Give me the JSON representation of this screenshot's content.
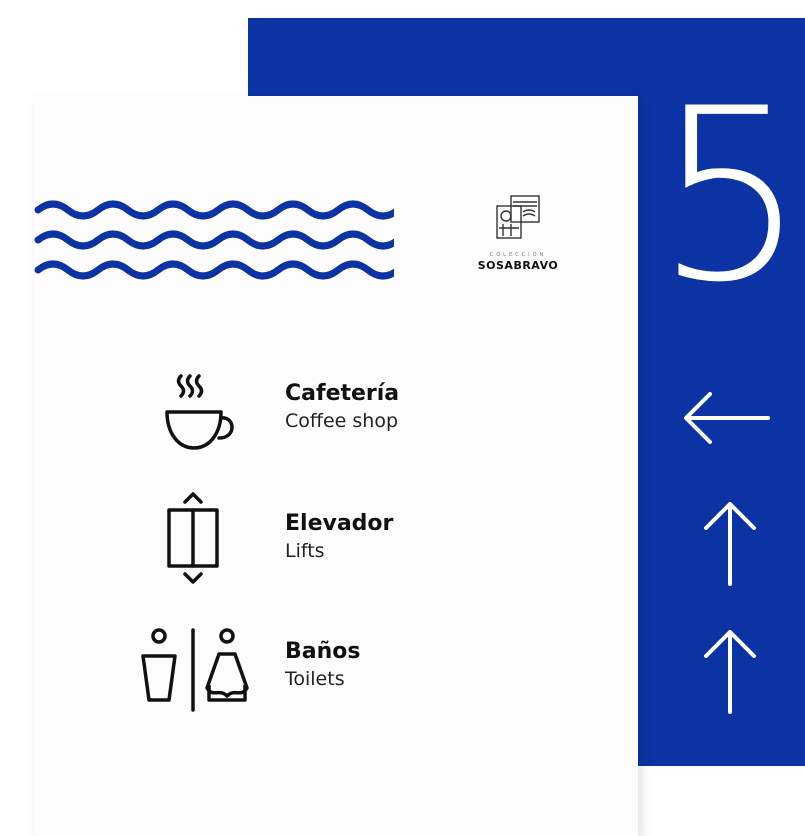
{
  "sign": {
    "floor_number": "5",
    "logo": {
      "subtitle": "COLECCIÓN",
      "name": "SOSABRAVO"
    },
    "destinations": [
      {
        "icon": "coffee-cup-icon",
        "name": "Cafetería",
        "translation": "Coffee shop",
        "arrow": "arrow-left-icon"
      },
      {
        "icon": "elevator-icon",
        "name": "Elevador",
        "translation": "Lifts",
        "arrow": "arrow-up-icon"
      },
      {
        "icon": "restroom-icon",
        "name": "Baños",
        "translation": "Toilets",
        "arrow": "arrow-up-icon"
      }
    ],
    "colors": {
      "accent_blue": "#0b33a3",
      "panel_white": "#fdfdfd",
      "text_dark": "#111111"
    }
  }
}
